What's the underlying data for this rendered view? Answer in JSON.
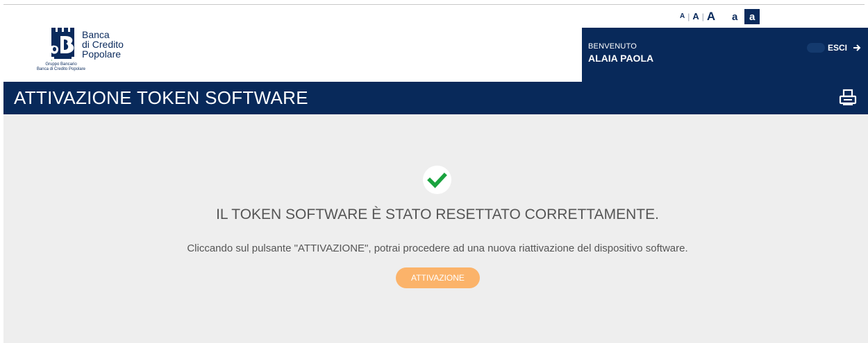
{
  "font_controls": {
    "small": "A",
    "medium": "A",
    "large": "A",
    "separator": "|",
    "contrast_normal": "a",
    "contrast_inverse": "a"
  },
  "logo": {
    "line1": "Banca",
    "line2": "di Credito",
    "line3": "Popolare",
    "group_line1": "Gruppo Bancario",
    "group_line2": "Banca di Credito Popolare"
  },
  "user": {
    "welcome_label": "BENVENUTO",
    "name": "ALAIA PAOLA",
    "logout_label": "ESCI"
  },
  "title_bar": {
    "title": "ATTIVAZIONE TOKEN SOFTWARE",
    "print_icon": "printer-icon"
  },
  "main": {
    "success_title": "IL TOKEN SOFTWARE È STATO RESETTATO CORRETTAMENTE.",
    "info_text": "Cliccando sul pulsante \"ATTIVAZIONE\", potrai procedere ad una nuova riattivazione del dispositivo software.",
    "activate_button": "ATTIVAZIONE"
  },
  "colors": {
    "brand_navy": "#08295a",
    "page_background": "#eeeeee",
    "button_orange": "#fbb36a",
    "success_green": "#1aa33f"
  }
}
